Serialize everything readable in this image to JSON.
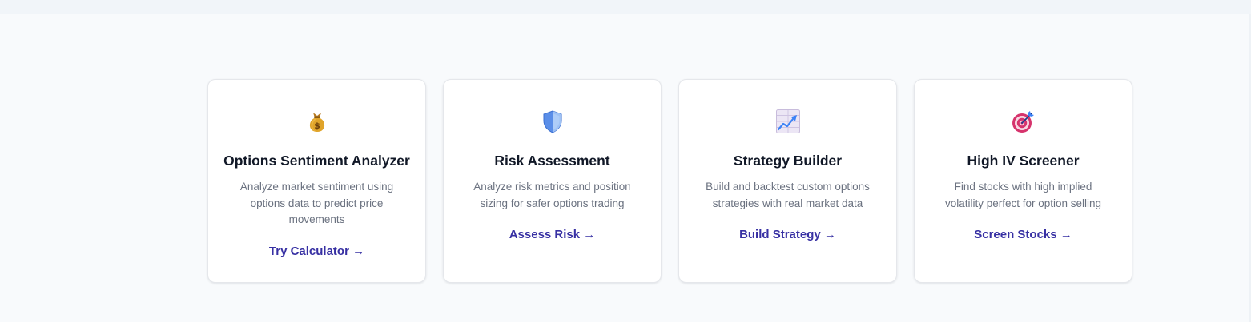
{
  "cards": [
    {
      "icon": "money-bag-icon",
      "title": "Options Sentiment Analyzer",
      "description": "Analyze market sentiment using options data to predict price movements",
      "link": "Try Calculator →"
    },
    {
      "icon": "shield-icon",
      "title": "Risk Assessment",
      "description": "Analyze risk metrics and position sizing for safer options trading",
      "link": "Assess Risk →"
    },
    {
      "icon": "chart-increasing-icon",
      "title": "Strategy Builder",
      "description": "Build and backtest custom options strategies with real market data",
      "link": "Build Strategy →"
    },
    {
      "icon": "target-icon",
      "title": "High IV Screener",
      "description": "Find stocks with high implied volatility perfect for option selling",
      "link": "Screen Stocks →"
    }
  ],
  "colors": {
    "background": "#f8fafc",
    "card": "#ffffff",
    "title": "#111827",
    "description": "#6b7280",
    "link": "#3730a3"
  }
}
